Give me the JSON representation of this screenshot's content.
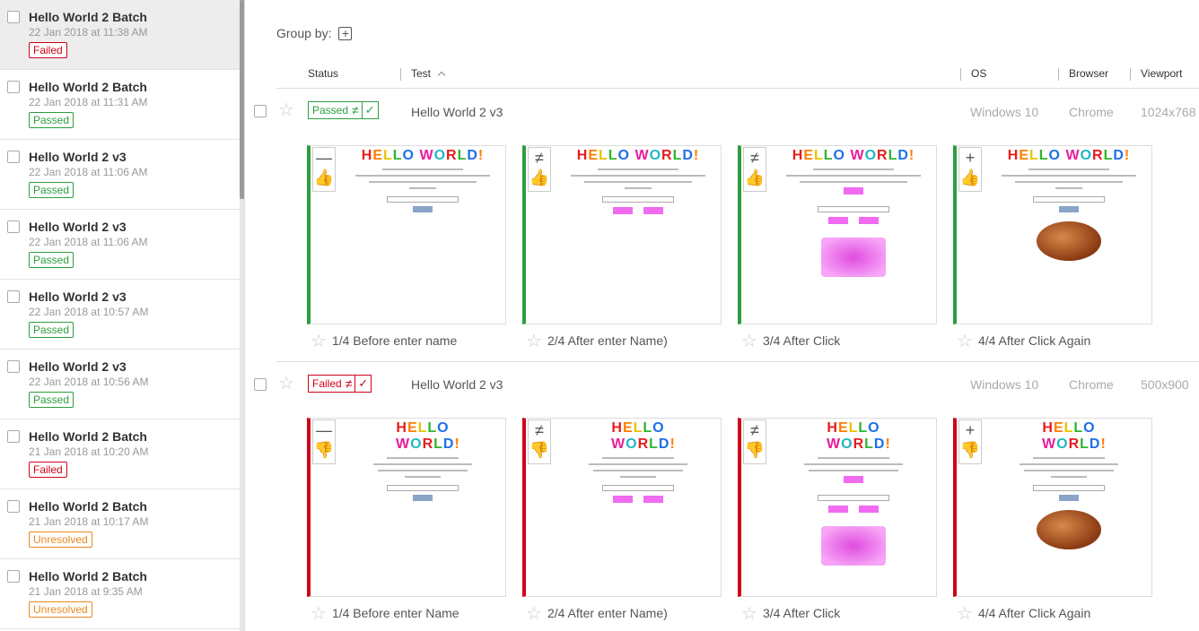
{
  "sidebar": {
    "batches": [
      {
        "name": "Hello World 2 Batch",
        "date": "22 Jan 2018 at 11:38 AM",
        "status": "Failed"
      },
      {
        "name": "Hello World 2 Batch",
        "date": "22 Jan 2018 at 11:31 AM",
        "status": "Passed"
      },
      {
        "name": "Hello World 2 v3",
        "date": "22 Jan 2018 at 11:06 AM",
        "status": "Passed"
      },
      {
        "name": "Hello World 2 v3",
        "date": "22 Jan 2018 at 11:06 AM",
        "status": "Passed"
      },
      {
        "name": "Hello World 2 v3",
        "date": "22 Jan 2018 at 10:57 AM",
        "status": "Passed"
      },
      {
        "name": "Hello World 2 v3",
        "date": "22 Jan 2018 at 10:56 AM",
        "status": "Passed"
      },
      {
        "name": "Hello World 2 Batch",
        "date": "21 Jan 2018 at 10:20 AM",
        "status": "Failed"
      },
      {
        "name": "Hello World 2 Batch",
        "date": "21 Jan 2018 at 10:17 AM",
        "status": "Unresolved"
      },
      {
        "name": "Hello World 2 Batch",
        "date": "21 Jan 2018 at 9:35 AM",
        "status": "Unresolved"
      }
    ]
  },
  "toolbar": {
    "group_by_label": "Group by:"
  },
  "columns": {
    "status": "Status",
    "test": "Test",
    "os": "OS",
    "browser": "Browser",
    "viewport": "Viewport",
    "sort_icon": "chevron-up-icon"
  },
  "tests": [
    {
      "status": "Passed",
      "neq": "≠",
      "name": "Hello World 2 v3",
      "os": "Windows 10",
      "browser": "Chrome",
      "viewport": "1024x768",
      "steps": [
        {
          "label": "1/4 Before enter name",
          "symbol": "—"
        },
        {
          "label": "2/4 After enter Name)",
          "symbol": "≠"
        },
        {
          "label": "3/4 After Click",
          "symbol": "≠"
        },
        {
          "label": "4/4 After Click Again",
          "symbol": "+"
        }
      ]
    },
    {
      "status": "Failed",
      "neq": "≠",
      "name": "Hello World 2 v3",
      "os": "Windows 10",
      "browser": "Chrome",
      "viewport": "500x900",
      "steps": [
        {
          "label": "1/4 Before enter Name",
          "symbol": "—"
        },
        {
          "label": "2/4 After enter Name)",
          "symbol": "≠"
        },
        {
          "label": "3/4 After Click",
          "symbol": "≠"
        },
        {
          "label": "4/4 After Click Again",
          "symbol": "+"
        }
      ]
    }
  ],
  "screenshot_text": {
    "hello_world": "HELLO WORLD!"
  },
  "colors": {
    "passed": "#2e9e3f",
    "failed": "#d0021b",
    "unresolved": "#e8891e"
  }
}
